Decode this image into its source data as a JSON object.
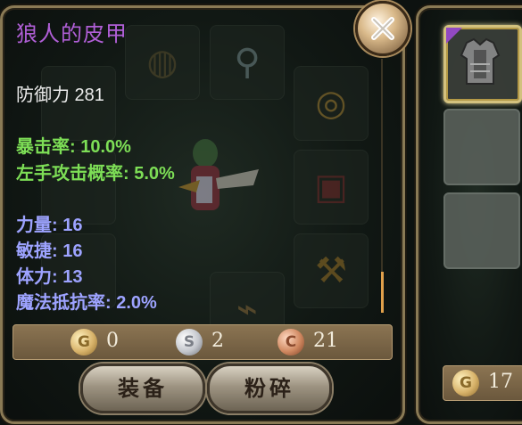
{
  "item": {
    "title": "狼人的皮甲",
    "base_stat": "防御力 281",
    "bonus_stats": [
      "暴击率: 10.0%",
      "左手攻击概率: 5.0%"
    ],
    "attributes": [
      "力量: 16",
      "敏捷: 16",
      "体力: 13",
      "魔法抵抗率: 2.0%"
    ]
  },
  "price": {
    "gold": "0",
    "silver": "2",
    "copper": "21",
    "gold_coin_letter": "G",
    "silver_coin_letter": "S",
    "copper_coin_letter": "C"
  },
  "buttons": {
    "equip": "装备",
    "shatter": "粉碎"
  },
  "side_panel": {
    "gold_amount": "17",
    "gold_coin_letter": "G",
    "selected_item_icon": "leather-armor-icon"
  },
  "colors": {
    "title": "#b05fd6",
    "bonus_stat": "#7dde56",
    "attribute": "#9da3ff",
    "rarity_corner": "#a04fd6",
    "frame_gold": "#8a7a55"
  },
  "icons": [
    "close-icon",
    "ring-icon",
    "necklace-icon",
    "armor-icon",
    "axe-icon",
    "boot-icon",
    "gold-coin-icon",
    "silver-coin-icon",
    "copper-coin-icon"
  ]
}
